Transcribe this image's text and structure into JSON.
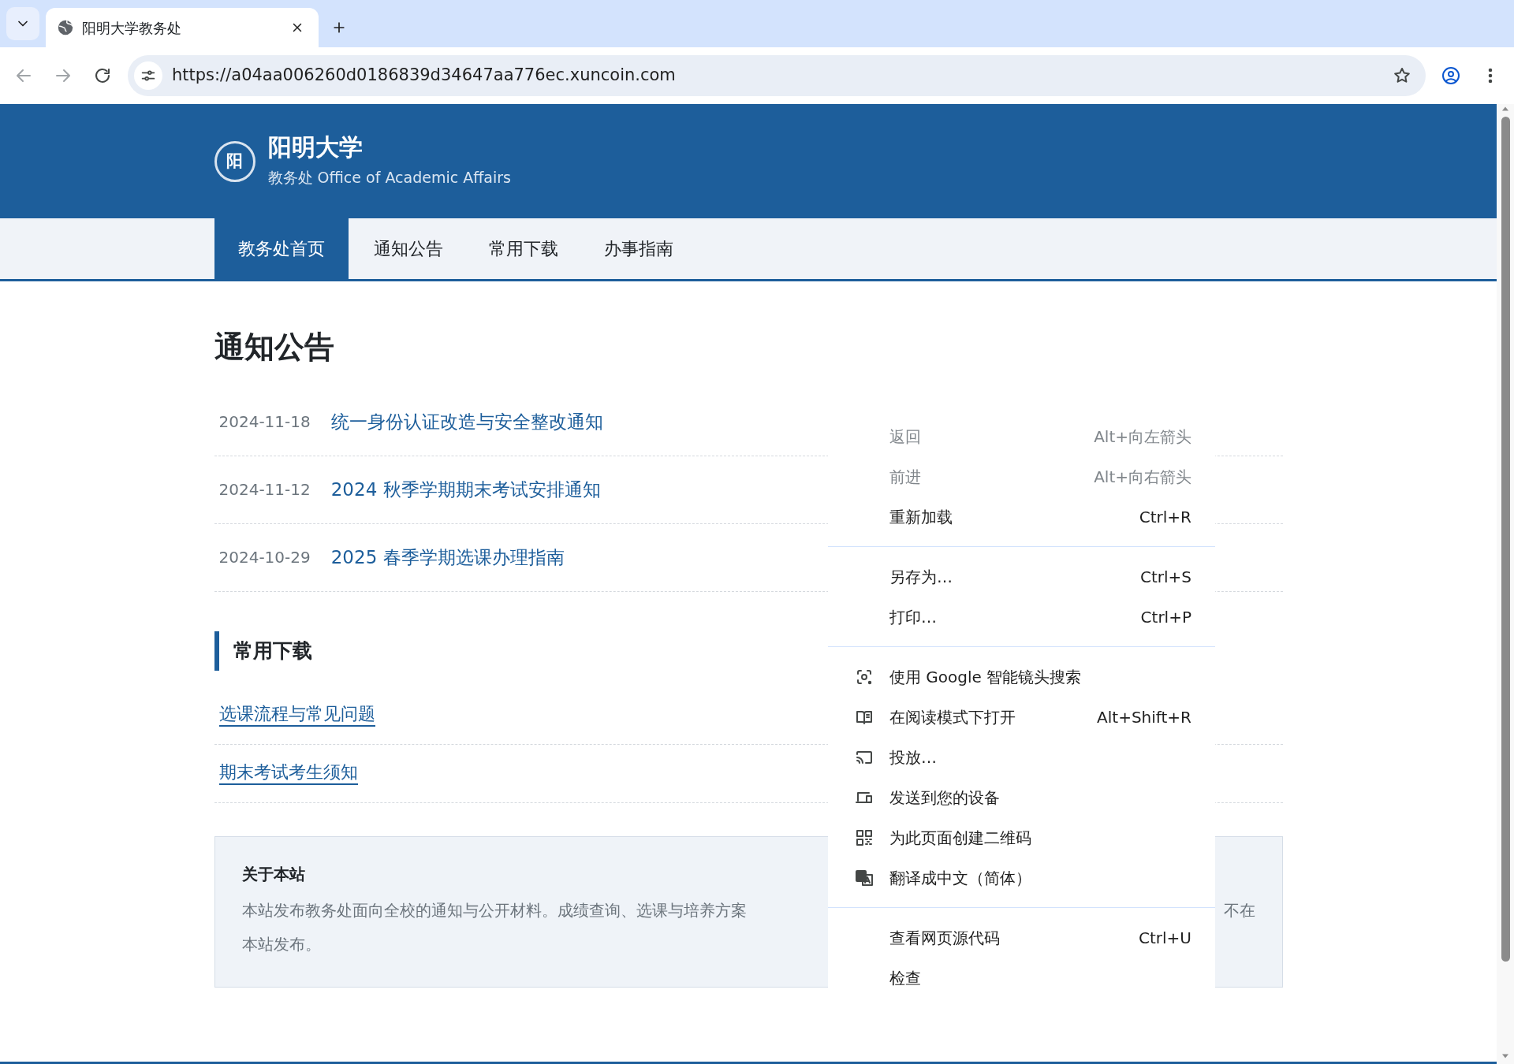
{
  "browser": {
    "tab_title": "阳明大学教务处",
    "url": "https://a04aa006260d0186839d34647aa776ec.xuncoin.com"
  },
  "site": {
    "logo_char": "阳",
    "name": "阳明大学",
    "subtitle": "教务处 Office of Academic Affairs"
  },
  "nav": [
    {
      "label": "教务处首页",
      "selected": true
    },
    {
      "label": "通知公告",
      "selected": false
    },
    {
      "label": "常用下载",
      "selected": false
    },
    {
      "label": "办事指南",
      "selected": false
    }
  ],
  "notices": {
    "title": "通知公告",
    "items": [
      {
        "date": "2024-11-18",
        "title": "统一身份认证改造与安全整改通知"
      },
      {
        "date": "2024-11-12",
        "title": "2024 秋季学期期末考试安排通知"
      },
      {
        "date": "2024-10-29",
        "title": "2025 春季学期选课办理指南"
      }
    ]
  },
  "downloads": {
    "title": "常用下载",
    "items": [
      "选课流程与常见问题",
      "期末考试考生须知"
    ]
  },
  "about": {
    "title": "关于本站",
    "text_left": "本站发布教务处面向全校的通知与公开材料。成绩查询、选课与培养方案",
    "text_right": "不在",
    "text_line2": "本站发布。"
  },
  "context_menu": {
    "groups": [
      [
        {
          "kind": "plain",
          "label": "返回",
          "shortcut": "Alt+向左箭头",
          "disabled": true
        },
        {
          "kind": "plain",
          "label": "前进",
          "shortcut": "Alt+向右箭头",
          "disabled": true
        },
        {
          "kind": "plain",
          "label": "重新加载",
          "shortcut": "Ctrl+R",
          "disabled": false
        }
      ],
      [
        {
          "kind": "plain",
          "label": "另存为…",
          "shortcut": "Ctrl+S",
          "disabled": false
        },
        {
          "kind": "plain",
          "label": "打印…",
          "shortcut": "Ctrl+P",
          "disabled": false
        }
      ],
      [
        {
          "kind": "lens",
          "label": "使用 Google 智能镜头搜索",
          "disabled": false
        },
        {
          "kind": "reader",
          "label": "在阅读模式下打开",
          "shortcut": "Alt+Shift+R",
          "disabled": false
        },
        {
          "kind": "cast",
          "label": "投放…",
          "disabled": false
        },
        {
          "kind": "devices",
          "label": "发送到您的设备",
          "disabled": false
        },
        {
          "kind": "qr",
          "label": "为此页面创建二维码",
          "disabled": false
        },
        {
          "kind": "translate",
          "label": "翻译成中文（简体）",
          "disabled": false
        }
      ],
      [
        {
          "kind": "plain",
          "label": "查看网页源代码",
          "shortcut": "Ctrl+U",
          "disabled": false
        },
        {
          "kind": "plain",
          "label": "检查",
          "disabled": false
        }
      ]
    ]
  }
}
